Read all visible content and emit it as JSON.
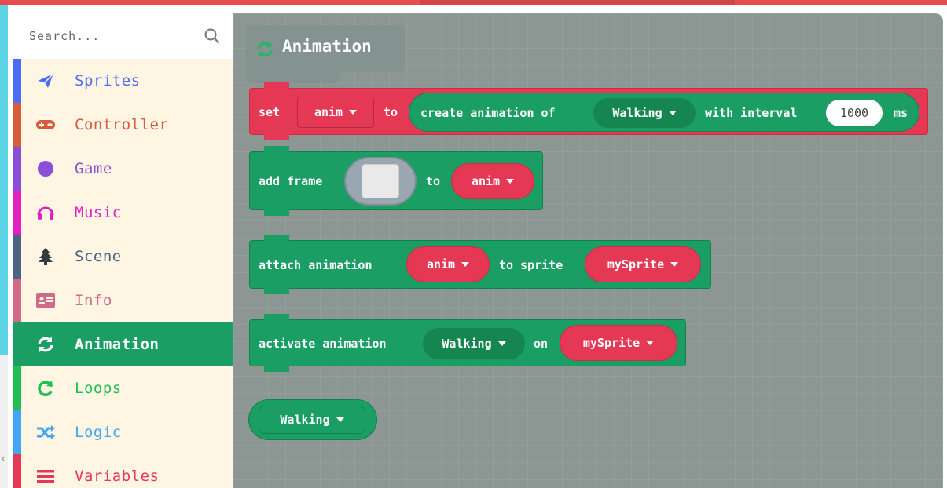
{
  "search": {
    "placeholder": "Search..."
  },
  "toolbox": {
    "categories": [
      {
        "label": "Sprites",
        "color": "#4b6cf7",
        "icon": "paper-plane-icon"
      },
      {
        "label": "Controller",
        "color": "#d65c3b",
        "icon": "gamepad-icon"
      },
      {
        "label": "Game",
        "color": "#8a4fd6",
        "icon": "circle-icon"
      },
      {
        "label": "Music",
        "color": "#e020c1",
        "icon": "headphones-icon"
      },
      {
        "label": "Scene",
        "color": "#4b6482",
        "icon": "tree-icon"
      },
      {
        "label": "Info",
        "color": "#cf6a87",
        "icon": "id-card-icon"
      },
      {
        "label": "Animation",
        "color": "#1a9e63",
        "icon": "refresh-icon",
        "selected": true
      },
      {
        "label": "Loops",
        "color": "#20bf55",
        "icon": "loop-arrow-icon"
      },
      {
        "label": "Logic",
        "color": "#42a5f5",
        "icon": "shuffle-icon"
      },
      {
        "label": "Variables",
        "color": "#e53855",
        "icon": "list-icon"
      }
    ]
  },
  "flyout": {
    "title": "Animation",
    "blocks": {
      "set": {
        "kw_set": "set",
        "var": "anim",
        "kw_to": "to",
        "create_label": "create animation of",
        "action": "Walking",
        "interval_label": "with interval",
        "interval": "1000",
        "unit": "ms"
      },
      "add_frame": {
        "label": "add frame",
        "kw_to": "to",
        "var": "anim"
      },
      "attach": {
        "label": "attach animation",
        "var": "anim",
        "kw_to_sprite": "to sprite",
        "sprite": "mySprite"
      },
      "activate": {
        "label": "activate animation",
        "action": "Walking",
        "kw_on": "on",
        "sprite": "mySprite"
      },
      "action_reporter": {
        "action": "Walking"
      }
    }
  },
  "colors": {
    "accent_green": "#1a9e63",
    "variable_red": "#e53855",
    "workspace": "#8c9793"
  }
}
